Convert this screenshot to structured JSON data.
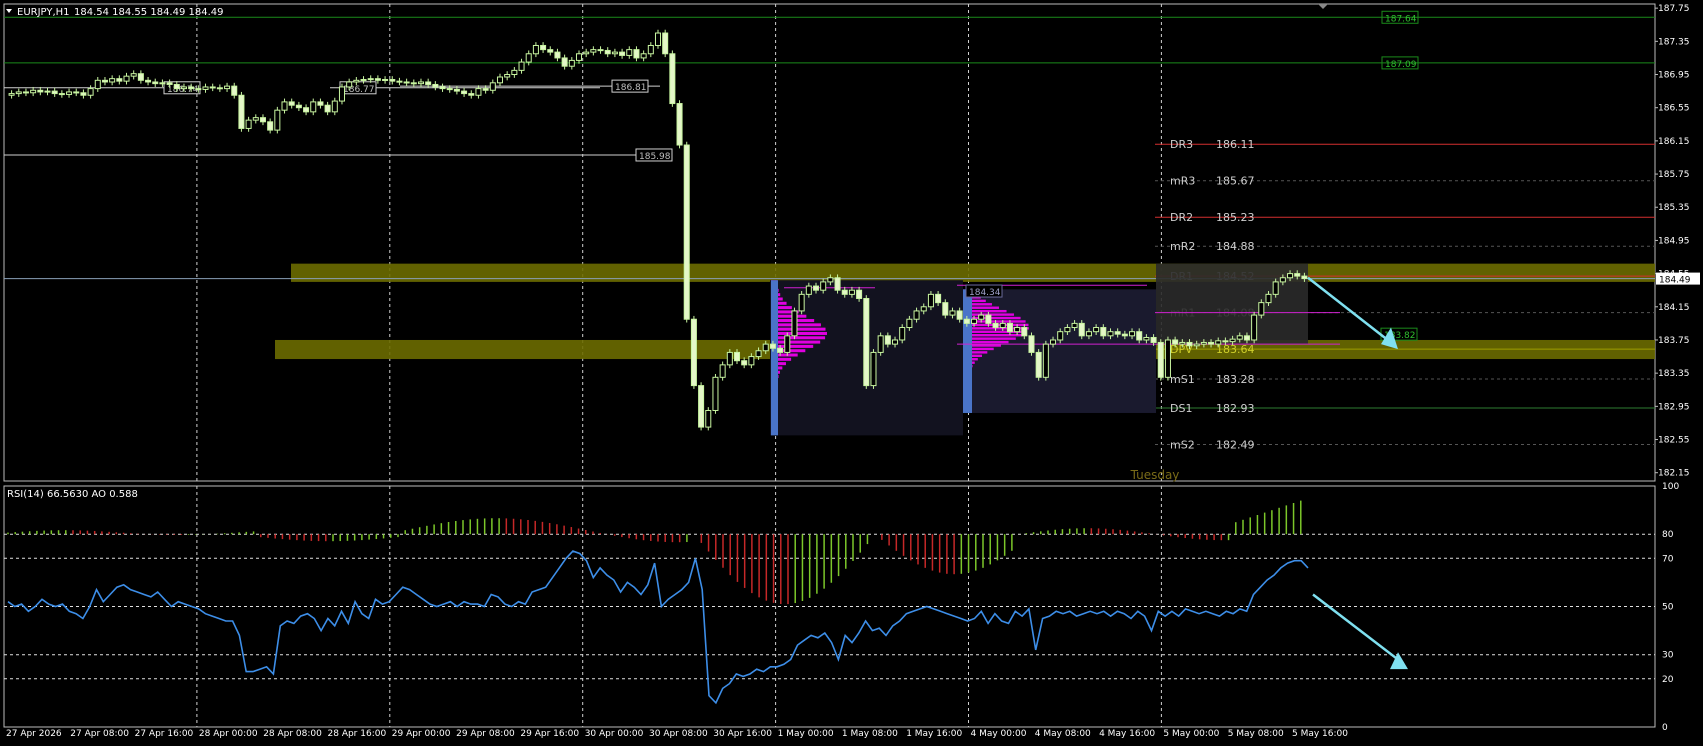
{
  "chart_data": {
    "type": "candlestick",
    "symbol": "EURJPY,H1",
    "ohlc_header": "184.54 184.55 184.49 184.49",
    "current_price": "184.49",
    "y_ticks": [
      "187.75",
      "187.35",
      "186.95",
      "186.55",
      "186.15",
      "185.75",
      "185.35",
      "184.95",
      "184.55",
      "184.15",
      "183.75",
      "183.35",
      "182.95",
      "182.55",
      "182.15"
    ],
    "x_ticks": [
      "27 Apr 2026",
      "27 Apr 08:00",
      "27 Apr 16:00",
      "28 Apr 00:00",
      "28 Apr 08:00",
      "28 Apr 16:00",
      "29 Apr 00:00",
      "29 Apr 08:00",
      "29 Apr 16:00",
      "30 Apr 00:00",
      "30 Apr 08:00",
      "30 Apr 16:00",
      "1 May 00:00",
      "1 May 08:00",
      "1 May 16:00",
      "4 May 00:00",
      "4 May 08:00",
      "4 May 16:00",
      "5 May 00:00",
      "5 May 08:00",
      "5 May 16:00"
    ],
    "price_range": [
      182.05,
      187.8
    ],
    "pivot_levels": [
      {
        "name": "DR3",
        "value": "186.11",
        "color": "#d32f2f"
      },
      {
        "name": "mR3",
        "value": "185.67",
        "color": "#555555"
      },
      {
        "name": "DR2",
        "value": "185.23",
        "color": "#d32f2f"
      },
      {
        "name": "mR2",
        "value": "184.88",
        "color": "#555555"
      },
      {
        "name": "DR1",
        "value": "184.52",
        "color": "#d32f2f"
      },
      {
        "name": "mR1",
        "value": "184.08",
        "color": "#555555"
      },
      {
        "name": "DPV",
        "value": "183.64",
        "color": "#9e9e00"
      },
      {
        "name": "mS1",
        "value": "183.28",
        "color": "#555555"
      },
      {
        "name": "DS1",
        "value": "182.93",
        "color": "#2e7d32"
      },
      {
        "name": "mS2",
        "value": "182.49",
        "color": "#555555"
      }
    ],
    "level_labels": [
      "187.64",
      "187.09",
      "186.74",
      "186.77",
      "186.81",
      "185.98",
      "184.34",
      "183.82"
    ],
    "session_label": "Tuesday",
    "indicator_header": "RSI(14) 66.5630  AO 0.588",
    "indicator_ticks": [
      "100",
      "80",
      "70",
      "50",
      "30",
      "20",
      "0"
    ],
    "indicator_levels": [
      100,
      80,
      70,
      50,
      30,
      20,
      0
    ],
    "rsi_values": [
      52,
      50,
      51,
      48,
      50,
      53,
      51,
      50,
      51,
      48,
      47,
      45,
      50,
      57,
      52,
      55,
      58,
      59,
      57,
      56,
      55,
      54,
      56,
      53,
      50,
      52,
      51,
      50,
      49,
      47,
      46,
      45,
      44,
      44,
      38,
      23,
      23,
      24,
      25,
      22,
      42,
      44,
      43,
      46,
      47,
      45,
      40,
      45,
      42,
      48,
      43,
      52,
      47,
      45,
      53,
      51,
      52,
      55,
      58,
      57,
      55,
      53,
      51,
      50,
      51,
      52,
      50,
      52,
      51,
      51,
      50,
      55,
      54,
      51,
      50,
      52,
      51,
      56,
      57,
      58,
      62,
      66,
      70,
      73,
      72,
      69,
      62,
      66,
      63,
      61,
      56,
      60,
      58,
      55,
      59,
      68,
      50,
      53,
      55,
      57,
      60,
      70,
      57,
      13,
      10,
      16,
      18,
      22,
      21,
      22,
      24,
      23,
      25,
      25,
      26,
      28,
      34,
      36,
      38,
      37,
      39,
      35,
      28,
      38,
      35,
      39,
      44,
      40,
      41,
      38,
      42,
      44,
      47,
      48,
      49,
      50,
      49,
      48,
      47,
      46,
      45,
      44,
      45,
      48,
      43,
      47,
      44,
      43,
      48,
      46,
      49,
      32,
      45,
      46,
      48,
      47,
      48,
      46,
      47,
      48,
      47,
      48,
      46,
      48,
      47,
      45,
      48,
      46,
      40,
      48,
      46,
      48,
      46,
      49,
      48,
      47,
      48,
      47,
      46,
      48,
      47,
      49,
      48,
      55,
      58,
      61,
      63,
      66,
      68,
      69,
      69,
      66
    ]
  }
}
